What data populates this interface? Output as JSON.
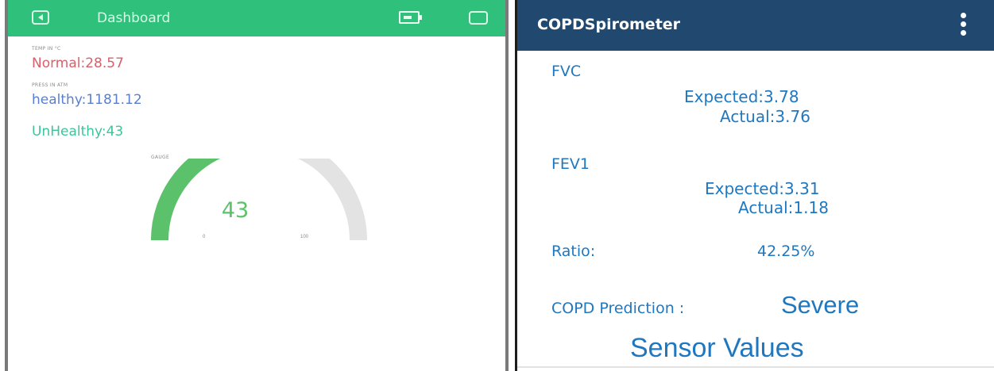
{
  "left_panel": {
    "header": {
      "title": "Dashboard",
      "accent": "#2fc17b"
    },
    "temperature": {
      "label": "TEMP IN °C",
      "value_text": "Normal:28.57",
      "color": "#d95f6b"
    },
    "pressure": {
      "label": "PRESS IN ATM",
      "value_text": "healthy:1181.12",
      "color": "#5a7fd1"
    },
    "unhealthy": {
      "value_text": "UnHealthy:43",
      "color": "#3cc49a"
    },
    "gauge": {
      "label": "GAUGE",
      "value": 43,
      "value_text": "43",
      "min": 0,
      "max": 100,
      "min_label": "0",
      "max_label": "100",
      "fill_color": "#5cc16b"
    }
  },
  "right_panel": {
    "header": {
      "title": "COPDSpirometer",
      "bg": "#21496f"
    },
    "fvc": {
      "heading": "FVC",
      "expected": "Expected:3.78",
      "actual": "Actual:3.76"
    },
    "fev1": {
      "heading": "FEV1",
      "expected": "Expected:3.31",
      "actual": "Actual:1.18"
    },
    "ratio": {
      "label": "Ratio:",
      "value": "42.25%"
    },
    "copd_prediction": {
      "label": "COPD Prediction :",
      "value": "Severe"
    },
    "sensor_values_link": "Sensor Values",
    "text_color": "#1f77c0"
  }
}
